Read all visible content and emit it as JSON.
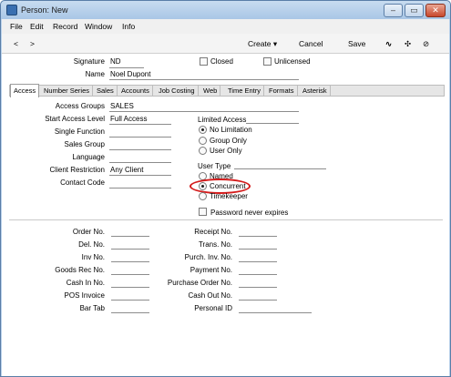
{
  "window": {
    "title": "Person: New"
  },
  "menu": [
    "File",
    "Edit",
    "Record",
    "Window",
    "Info"
  ],
  "toolbar": {
    "prev": "<",
    "next": ">",
    "create": "Create",
    "cancel": "Cancel",
    "save": "Save"
  },
  "header": {
    "signature_label": "Signature",
    "signature_value": "ND",
    "name_label": "Name",
    "name_value": "Noel Dupont",
    "closed_label": "Closed",
    "unlicensed_label": "Unlicensed"
  },
  "tabs": [
    "Access",
    "Number Series",
    "Sales",
    "Accounts",
    "Job Costing",
    "Web",
    "Time Entry",
    "Formats",
    "Asterisk"
  ],
  "access": {
    "access_groups_label": "Access Groups",
    "access_groups_value": "SALES",
    "start_access_level_label": "Start Access Level",
    "start_access_level_value": "Full Access",
    "single_function_label": "Single Function",
    "sales_group_label": "Sales Group",
    "language_label": "Language",
    "client_restriction_label": "Client Restriction",
    "client_restriction_value": "Any Client",
    "contact_code_label": "Contact Code",
    "limited_access_label": "Limited Access",
    "limited_options": [
      {
        "label": "No Limitation",
        "selected": true
      },
      {
        "label": "Group Only",
        "selected": false
      },
      {
        "label": "User Only",
        "selected": false
      }
    ],
    "user_type_label": "User Type",
    "user_type_options": [
      {
        "label": "Named",
        "selected": false
      },
      {
        "label": "Concurrent",
        "selected": true
      },
      {
        "label": "Timekeeper",
        "selected": false
      }
    ],
    "password_never_expires_label": "Password never expires"
  },
  "numbers": {
    "left": [
      "Order No.",
      "Del. No.",
      "Inv No.",
      "Goods Rec No.",
      "Cash In No.",
      "POS Invoice",
      "Bar Tab"
    ],
    "right": [
      "Receipt No.",
      "Trans. No.",
      "Purch. Inv. No.",
      "Payment No.",
      "Purchase Order No.",
      "Cash Out No.",
      "Personal ID"
    ]
  }
}
